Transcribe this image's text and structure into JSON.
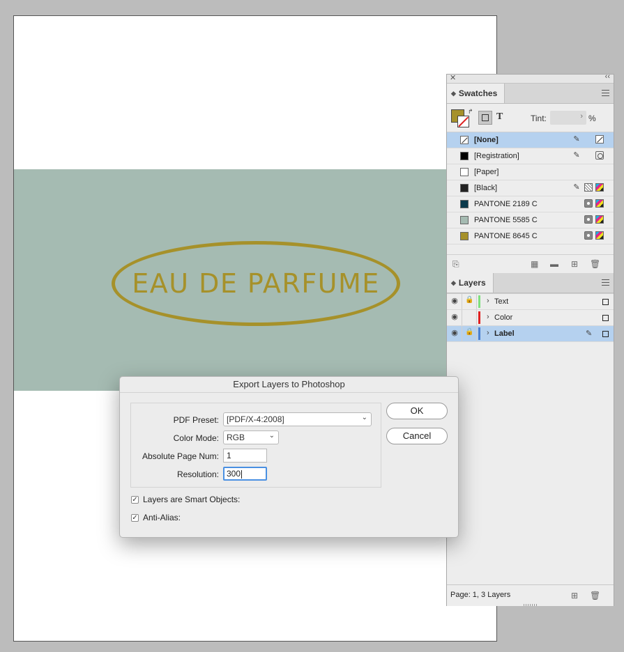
{
  "document": {
    "label_text": "EAU DE PARFUME",
    "background_color": "#a5bbb2",
    "accent_color": "#a6912a"
  },
  "panel": {
    "close_icon": "close-icon",
    "collapse_icon": "double-chevron-icon"
  },
  "swatches": {
    "tab_label": "Swatches",
    "tint_label": "Tint:",
    "tint_value": "",
    "tint_unit": "%",
    "text_mode_label": "T",
    "items": [
      {
        "name": "[None]",
        "color": "none",
        "selected": true
      },
      {
        "name": "[Registration]",
        "color": "#000000"
      },
      {
        "name": "[Paper]",
        "color": "#ffffff"
      },
      {
        "name": "[Black]",
        "color": "#222222"
      },
      {
        "name": "PANTONE 2189 C",
        "color": "#0b3a4c"
      },
      {
        "name": "PANTONE 5585 C",
        "color": "#a5bbb2"
      },
      {
        "name": "PANTONE 8645 C",
        "color": "#a6912a"
      }
    ]
  },
  "layers": {
    "tab_label": "Layers",
    "items": [
      {
        "name": "Text",
        "color": "#7ee07e"
      },
      {
        "name": "Color",
        "color": "#e02020"
      },
      {
        "name": "Label",
        "color": "#4a7fd0",
        "selected": true
      }
    ],
    "status": "Page: 1, 3 Layers"
  },
  "dialog": {
    "title": "Export Layers to Photoshop",
    "pdf_preset_label": "PDF Preset:",
    "pdf_preset_value": "[PDF/X-4:2008]",
    "color_mode_label": "Color Mode:",
    "color_mode_value": "RGB",
    "page_num_label": "Absolute Page Num:",
    "page_num_value": "1",
    "resolution_label": "Resolution:",
    "resolution_value": "300",
    "smart_objects_label": "Layers are Smart Objects:",
    "anti_alias_label": "Anti-Alias:",
    "ok_label": "OK",
    "cancel_label": "Cancel"
  }
}
